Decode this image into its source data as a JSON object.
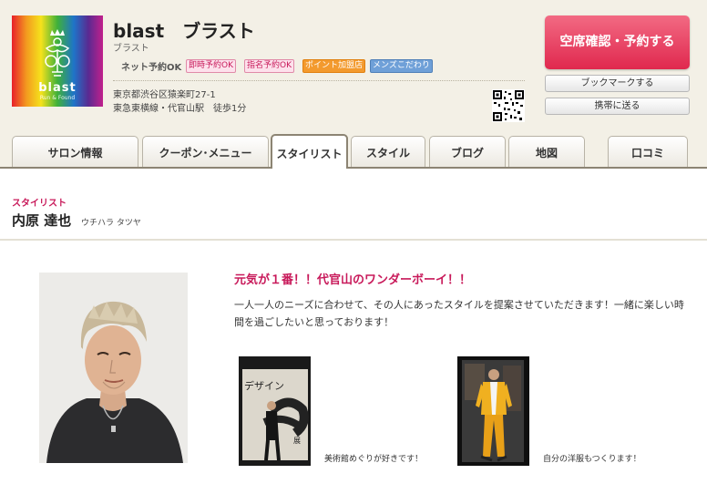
{
  "salon": {
    "name": "blast　ブラスト",
    "kana": "ブラスト",
    "logo_text": "blast",
    "logo_sub": "Run & Found",
    "net_reservation": "ネット予約OK",
    "badges": [
      "即時予約OK",
      "指名予約OK",
      "ポイント加盟店",
      "メンズこだわり"
    ],
    "address": "東京都渋谷区猿楽町27-1",
    "access": "東急東横線・代官山駅　徒歩1分"
  },
  "actions": {
    "reserve": "空席確認・予約する",
    "bookmark": "ブックマークする",
    "send_mobile": "携帯に送る"
  },
  "tabs": [
    "サロン情報",
    "クーポン･メニュー",
    "スタイリスト",
    "スタイル",
    "ブログ",
    "地図",
    "口コミ"
  ],
  "active_tab": "スタイリスト",
  "stylist": {
    "section_label": "スタイリスト",
    "name": "内原 達也",
    "kana": "ウチハラ タツヤ",
    "catchphrase": "元気が１番！！代官山のワンダーボーイ！！",
    "intro": "一人一人のニーズに合わせて、その人にあったスタイルを提案させていただきます！一緒に楽しい時間を過ごしたいと思っております！",
    "photos": [
      {
        "caption": "美術館めぐりが好きです！",
        "sign_text": "デザイン",
        "sign_text2": "展"
      },
      {
        "caption": "自分の洋服もつくります！"
      }
    ]
  },
  "colors": {
    "accent": "#c8195a",
    "reserve_button": "#e0284e",
    "header_bg": "#f3f0e6"
  }
}
